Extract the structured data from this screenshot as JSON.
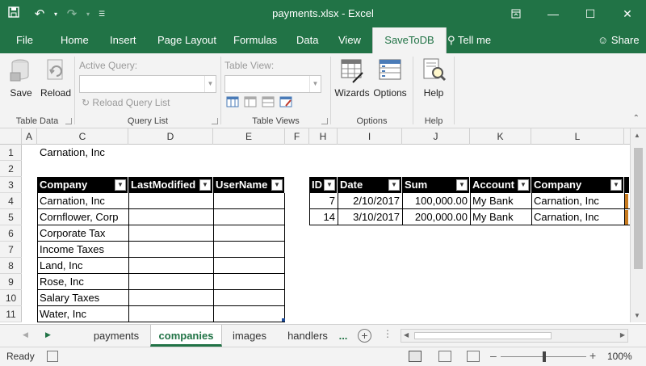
{
  "window": {
    "title": "payments.xlsx  -  Excel",
    "controls": [
      "restore-ribbon-icon",
      "minimize-icon",
      "maximize-icon",
      "close-icon"
    ]
  },
  "ribbon_tabs": [
    "File",
    "Home",
    "Insert",
    "Page Layout",
    "Formulas",
    "Data",
    "View",
    "SaveToDB",
    "Tell me",
    "Share"
  ],
  "active_tab": "SaveToDB",
  "ribbon": {
    "save_label": "Save",
    "reload_label": "Reload",
    "table_data_label": "Table Data",
    "active_query_label": "Active Query:",
    "reload_query_list_label": "Reload Query List",
    "query_list_label": "Query List",
    "table_view_label": "Table View:",
    "table_views_label": "Table Views",
    "wizards_label": "Wizards",
    "options_label": "Options",
    "options_group_label": "Options",
    "help_label": "Help",
    "help_group_label": "Help"
  },
  "columns": [
    "A",
    "C",
    "D",
    "E",
    "F",
    "H",
    "I",
    "J",
    "K",
    "L"
  ],
  "rows": [
    "1",
    "2",
    "3",
    "4",
    "5",
    "6",
    "7",
    "8",
    "9",
    "10",
    "11"
  ],
  "cells": {
    "c1": "Carnation, Inc"
  },
  "companies_table": {
    "headers": [
      "Company",
      "LastModified",
      "UserName"
    ],
    "rows": [
      "Carnation, Inc",
      "Cornflower, Corp",
      "Corporate Tax",
      "Income Taxes",
      "Land, Inc",
      "Rose, Inc",
      "Salary Taxes",
      "Water, Inc"
    ]
  },
  "payments_table": {
    "headers": [
      "ID",
      "Date",
      "Sum",
      "Account",
      "Company"
    ],
    "rows": [
      {
        "id": "7",
        "date": "2/10/2017",
        "sum": "100,000.00",
        "account": "My Bank",
        "company": "Carnation, Inc"
      },
      {
        "id": "14",
        "date": "3/10/2017",
        "sum": "200,000.00",
        "account": "My Bank",
        "company": "Carnation, Inc"
      }
    ]
  },
  "sheets": [
    "payments",
    "companies",
    "images",
    "handlers",
    "..."
  ],
  "active_sheet": "companies",
  "status": {
    "ready": "Ready",
    "zoom": "100%"
  },
  "colors": {
    "brand": "#217346",
    "table_header": "#000000"
  }
}
